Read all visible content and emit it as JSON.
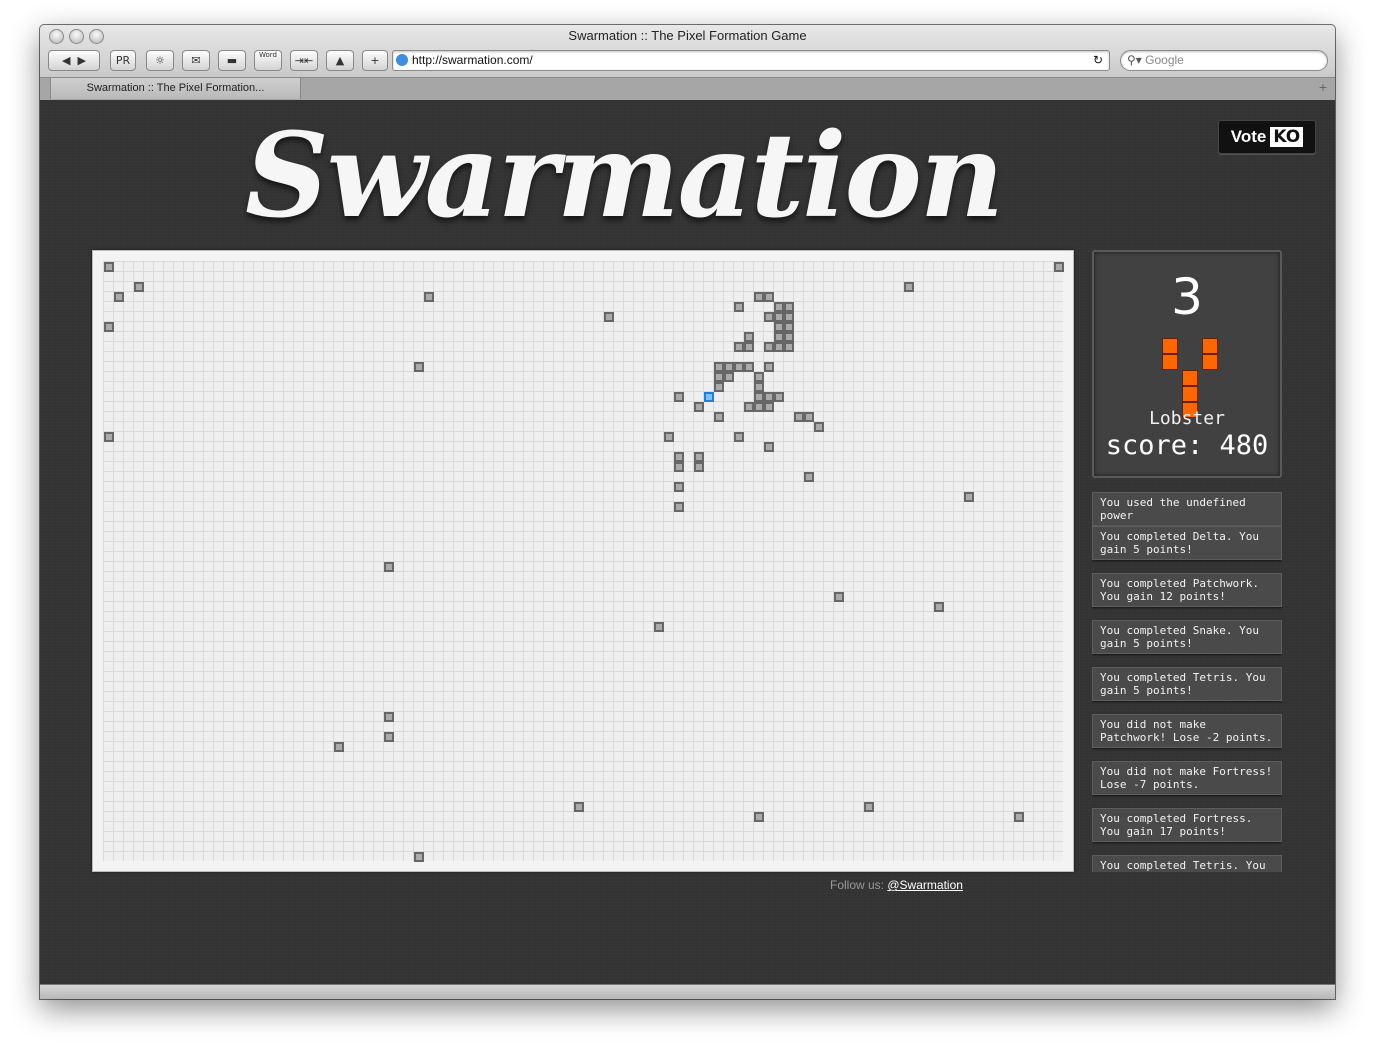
{
  "window": {
    "title": "Swarmation :: The Pixel Formation Game",
    "url": "http://swarmation.com/",
    "search_placeholder": "Google",
    "tab_label": "Swarmation :: The Pixel Formation..."
  },
  "toolbar": {
    "back_icon": "back-icon",
    "forward_icon": "forward-icon",
    "pr_label": "PR",
    "word_label": "Word"
  },
  "page": {
    "logo": "Swarmation",
    "vote_label": "Vote",
    "vote_ko": "KO",
    "follow_label": "Follow us:",
    "follow_link": "@Swarmation"
  },
  "game": {
    "countdown": "3",
    "formation_name": "Lobster",
    "score_label": "score: 480",
    "score_value": 480,
    "player_color": "#1a7fe0",
    "formation_color": "#ff6600"
  },
  "messages": [
    "You used the undefined power",
    "You completed Delta. You gain 5 points!",
    "You completed Patchwork. You gain 12 points!",
    "You completed Snake. You gain 5 points!",
    "You completed Tetris. You gain 5 points!",
    "You did not make Patchwork! Lose -2 points.",
    "You did not make Fortress! Lose -7 points.",
    "You completed Fortress. You gain 17 points!",
    "You completed Tetris. You"
  ]
}
